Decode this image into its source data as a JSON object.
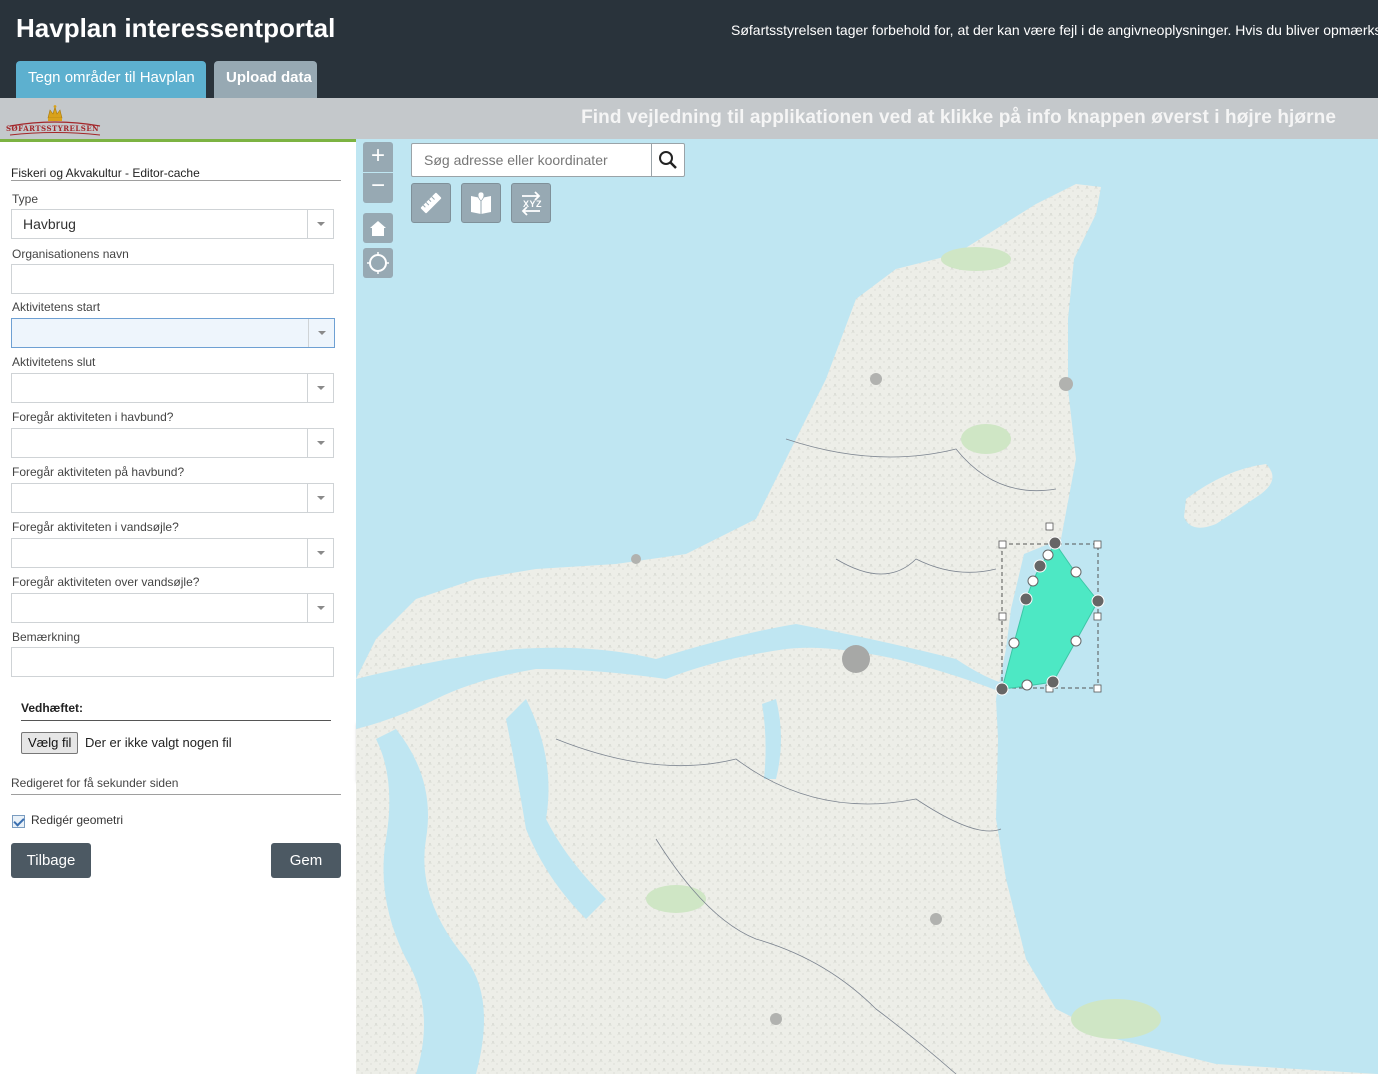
{
  "header": {
    "title": "Havplan interessentportal",
    "disclaimer": "Søfartsstyrelsen tager forbehold for, at der kan være fejl i de angivneoplysninger. Hvis du bliver opmærksom",
    "tabs": [
      {
        "label": "Tegn områder til Havplan"
      },
      {
        "label": "Upload data"
      }
    ]
  },
  "banner": {
    "logo_text": "SØFARTSSTYRELSEN",
    "guide_text": "Find vejledning til applikationen ved at klikke på info knappen øverst i højre hjørne"
  },
  "form": {
    "title": "Fiskeri og Akvakultur - Editor-cache",
    "fields": [
      {
        "label": "Type",
        "value": "Havbrug"
      },
      {
        "label": "Organisationens navn",
        "value": ""
      },
      {
        "label": "Aktivitetens start",
        "value": ""
      },
      {
        "label": "Aktivitetens slut",
        "value": ""
      },
      {
        "label": "Foregår aktiviteten i havbund?",
        "value": ""
      },
      {
        "label": "Foregår aktiviteten på havbund?",
        "value": ""
      },
      {
        "label": "Foregår aktiviteten i vandsøjle?",
        "value": ""
      },
      {
        "label": "Foregår aktiviteten over vandsøjle?",
        "value": ""
      },
      {
        "label": "Bemærkning",
        "value": ""
      }
    ],
    "attachment_label": "Vedhæftet:",
    "file_button": "Vælg fil",
    "file_status": "Der er ikke valgt nogen fil",
    "edited_status": "Redigeret for få sekunder siden",
    "edit_geometry_label": "Redigér geometri",
    "edit_geometry_checked": true,
    "back_button": "Tilbage",
    "save_button": "Gem"
  },
  "map": {
    "search_placeholder": "Søg adresse eller koordinater",
    "zoom_in": "+",
    "zoom_out": "−",
    "coords_tool_label": "XYZ",
    "sea_color": "#bfe6f2",
    "land_color": "#eeefe9",
    "polygon_color": "#4de8c4"
  }
}
